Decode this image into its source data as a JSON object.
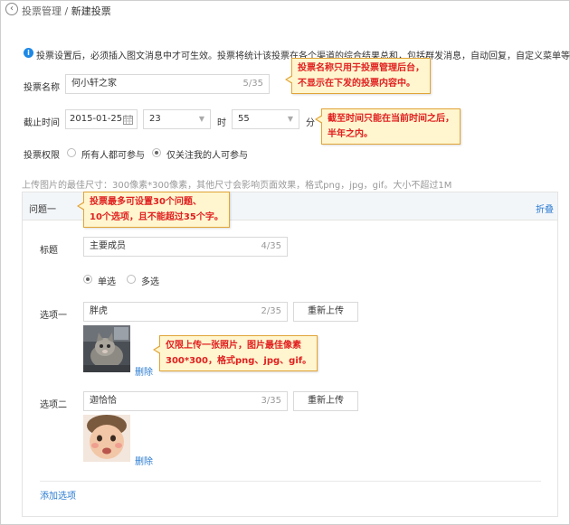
{
  "breadcrumb": {
    "parent": "投票管理",
    "separator": " / ",
    "current": "新建投票"
  },
  "notice": "投票设置后，必须插入图文消息中才可生效。投票将统计该投票在各个渠道的综合结果总和，包括群发消息，自动回复，自定义菜单等。",
  "form": {
    "name_label": "投票名称",
    "name_value": "何小轩之家",
    "name_count": "5/35",
    "deadline_label": "截止时间",
    "date_value": "2015-01-25",
    "hour_value": "23",
    "hour_unit": "时",
    "minute_value": "55",
    "minute_unit": "分",
    "permission_label": "投票权限",
    "permission_options": [
      "所有人都可参与",
      "仅关注我的人可参与"
    ],
    "permission_selected": "仅关注我的人可参与",
    "upload_hint": "上传图片的最佳尺寸：300像素*300像素，其他尺寸会影响页面效果，格式png，jpg，gif。大小不超过1M"
  },
  "question": {
    "header": "问题一",
    "collapse": "折叠",
    "title_label": "标题",
    "title_value": "主要成员",
    "title_count": "4/35",
    "type_options": [
      "单选",
      "多选"
    ],
    "type_selected": "单选",
    "options": [
      {
        "label": "选项一",
        "value": "胖虎",
        "count": "2/35",
        "reupload": "重新上传",
        "delete": "删除",
        "image": "cat-photo"
      },
      {
        "label": "选项二",
        "value": "迦恰恰",
        "count": "3/35",
        "reupload": "重新上传",
        "delete": "删除",
        "image": "baby-photo"
      }
    ],
    "add_option": "添加选项"
  },
  "tips": {
    "name": [
      "投票名称只用于投票管理后台，",
      "不显示在下发的投票内容中。"
    ],
    "deadline": [
      "截至时间只能在当前时间之后，",
      "半年之内。"
    ],
    "question": [
      "投票最多可设置30个问题、",
      "10个选项，且不能超过35个字。"
    ],
    "image": [
      "仅限上传一张照片，图片最佳像素",
      "300*300，格式png、jpg、gif。"
    ]
  },
  "icons": {
    "back": "back-arrow-icon",
    "info": "info-icon",
    "calendar": "calendar-icon",
    "dropdown": "chevron-down-icon"
  },
  "colors": {
    "link": "#2a7bd1",
    "info": "#1e88e5",
    "tip_bg": "#fff6cf",
    "tip_text": "#e02020",
    "tip_border": "#e1a437"
  }
}
